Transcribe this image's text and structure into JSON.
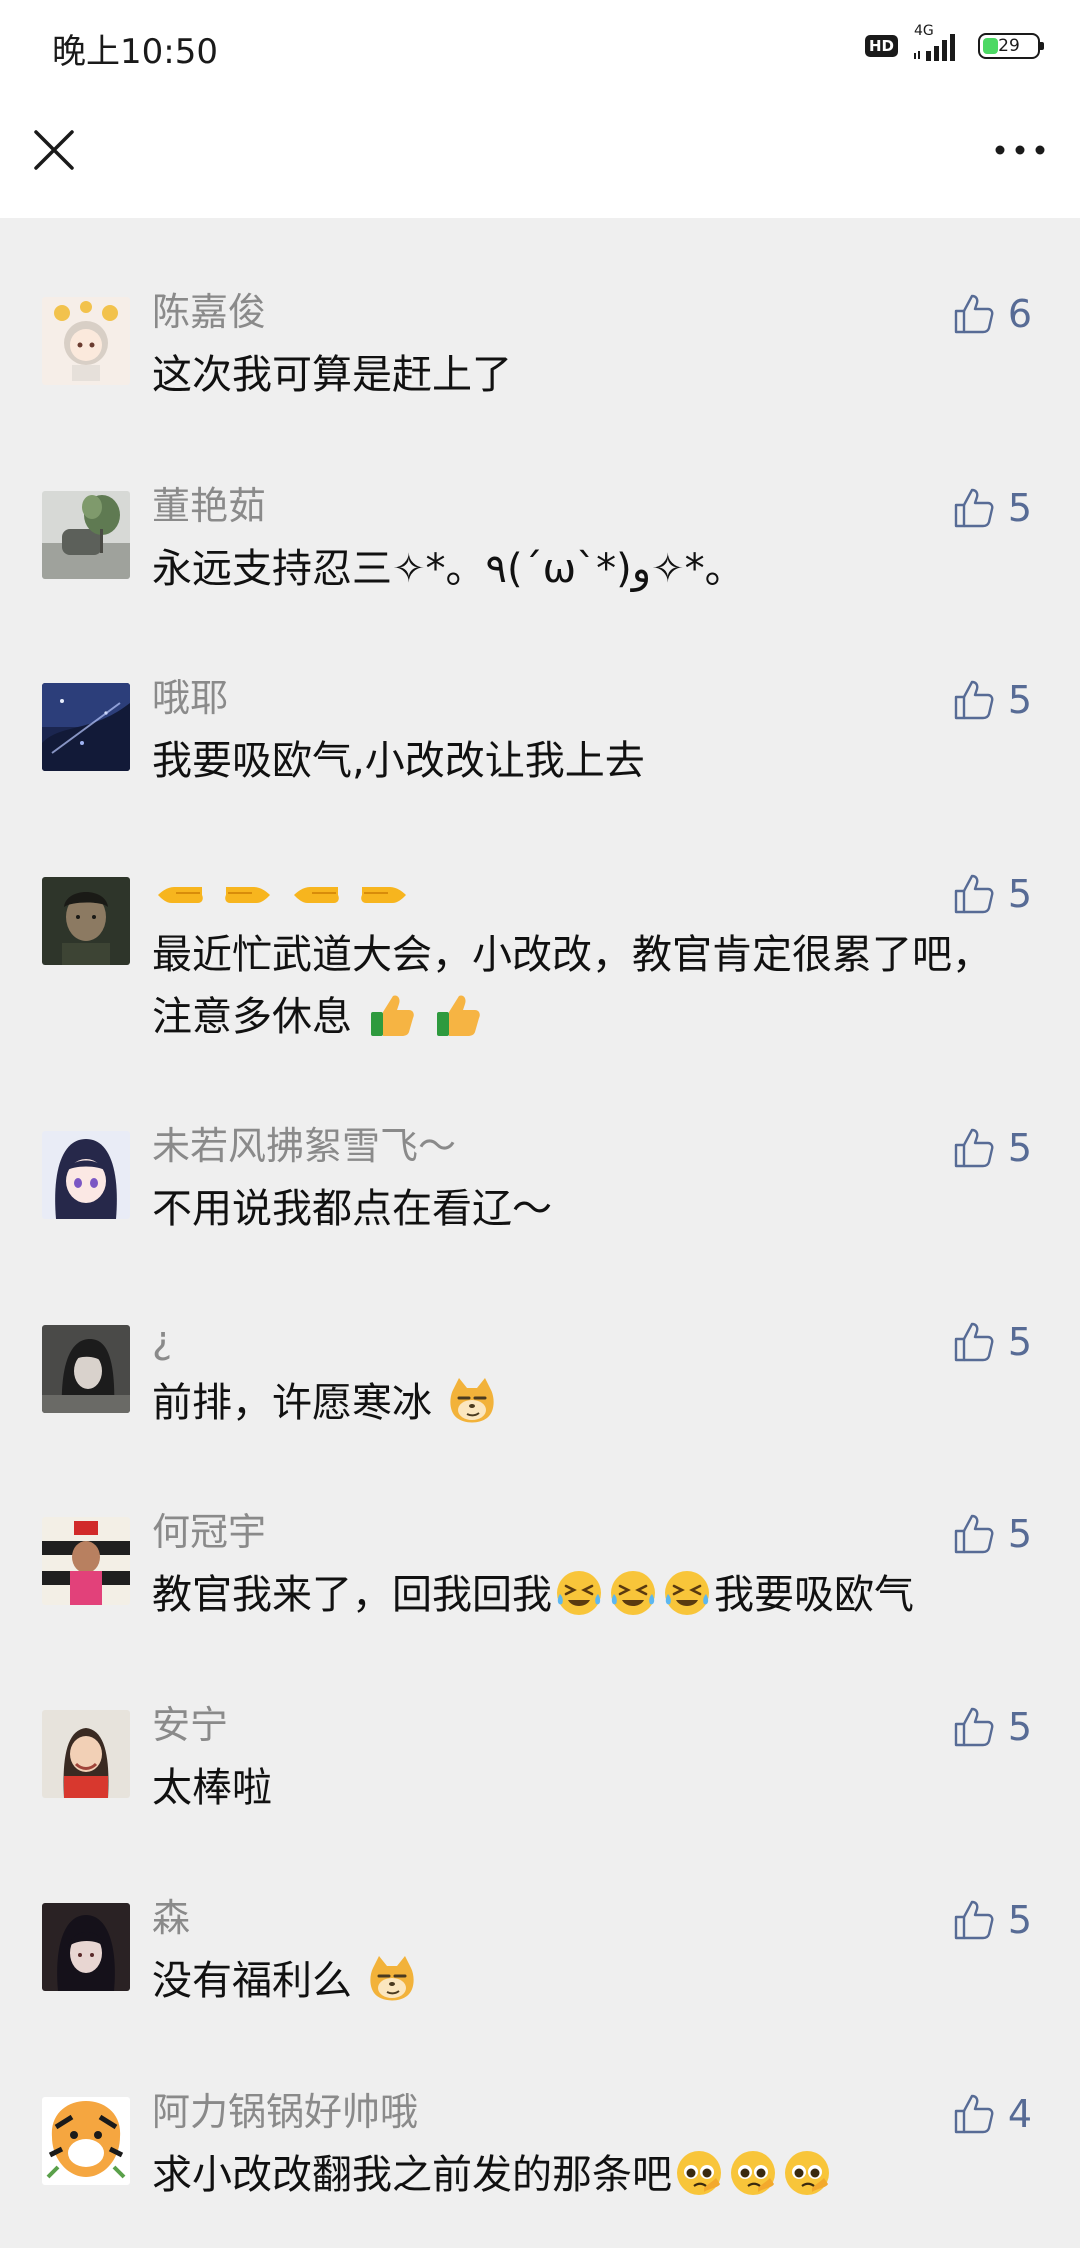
{
  "status_bar": {
    "time": "晚上10:50",
    "hd_label": "HD",
    "network_label": "4G",
    "battery_level": 29,
    "battery_text": "29"
  },
  "nav": {
    "close_icon": "close-icon",
    "more_icon": "more-dots-icon"
  },
  "colors": {
    "background": "#efefef",
    "nickname": "#8a8a8a",
    "like": "#576b95",
    "battery": "#4cd964"
  },
  "comments": [
    {
      "name": "陈嘉俊",
      "likes": "6",
      "text": "这次我可算是赶上了"
    },
    {
      "name": "董艳茹",
      "likes": "5",
      "text": "永远支持忍三✧*。٩(ˊωˋ*)و✧*。"
    },
    {
      "name": "哦耶",
      "likes": "5",
      "text": "我要吸欧气,小改改让我上去"
    },
    {
      "name": "",
      "name_emoji": [
        "point-left",
        "point-right",
        "point-left",
        "point-right"
      ],
      "likes": "5",
      "text": "最近忙武道大会，小改改，教官肯定很累了吧，注意多休息",
      "text_emoji": [
        "thumbs-up",
        "thumbs-up"
      ]
    },
    {
      "name": "未若风拂絮雪飞～",
      "likes": "5",
      "text": "不用说我都点在看辽～"
    },
    {
      "name": "¿",
      "likes": "5",
      "text": "前排，许愿寒冰",
      "text_emoji": [
        "smug-doge"
      ]
    },
    {
      "name": "何冠宇",
      "likes": "5",
      "text_a": "教官我来了，回我回我",
      "text_emoji": [
        "crying-laugh",
        "crying-laugh",
        "crying-laugh"
      ],
      "text_b": "我要吸欧气"
    },
    {
      "name": "安宁",
      "likes": "5",
      "text": "太棒啦"
    },
    {
      "name": "森",
      "likes": "5",
      "text": "没有福利么",
      "text_emoji": [
        "smug-doge"
      ]
    },
    {
      "name": "阿力锅锅好帅哦",
      "likes": "4",
      "text": "求小改改翻我之前发的那条吧",
      "text_emoji": [
        "pleading-face",
        "pleading-face",
        "pleading-face"
      ]
    }
  ]
}
